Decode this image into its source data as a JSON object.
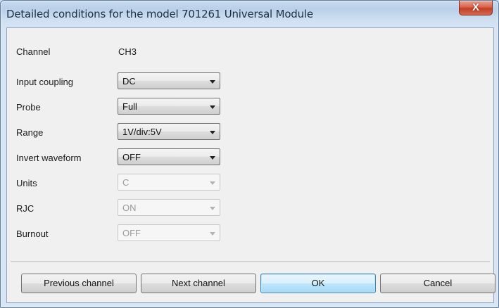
{
  "window": {
    "title": "Detailed conditions for the model 701261 Universal Module",
    "close_glyph": "X"
  },
  "form": {
    "channel": {
      "label": "Channel",
      "value": "CH3"
    },
    "input_coupling": {
      "label": "Input coupling",
      "value": "DC",
      "enabled": true
    },
    "probe": {
      "label": "Probe",
      "value": "Full",
      "enabled": true
    },
    "range": {
      "label": "Range",
      "value": "1V/div:5V",
      "enabled": true
    },
    "invert_waveform": {
      "label": "Invert waveform",
      "value": "OFF",
      "enabled": true
    },
    "units": {
      "label": "Units",
      "value": "C",
      "enabled": false
    },
    "rjc": {
      "label": "RJC",
      "value": "ON",
      "enabled": false
    },
    "burnout": {
      "label": "Burnout",
      "value": "OFF",
      "enabled": false
    }
  },
  "buttons": {
    "previous_channel": "Previous channel",
    "next_channel": "Next channel",
    "ok": "OK",
    "cancel": "Cancel"
  },
  "colors": {
    "accent": "#3c7fb1",
    "close_button": "#c43e24",
    "disabled_text": "#9a9a9a"
  },
  "icons": {
    "close": "close-icon",
    "dropdown": "chevron-down-icon"
  }
}
